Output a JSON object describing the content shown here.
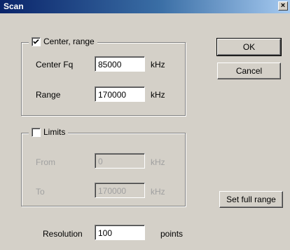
{
  "window": {
    "title": "Scan",
    "close_glyph": "×"
  },
  "center_group": {
    "checkbox_label": "Center, range",
    "checked": true,
    "center_label": "Center Fq",
    "center_value": "85000",
    "center_unit": "kHz",
    "range_label": "Range",
    "range_value": "170000",
    "range_unit": "kHz"
  },
  "limits_group": {
    "checkbox_label": "Limits",
    "checked": false,
    "from_label": "From",
    "from_value": "0",
    "from_unit": "kHz",
    "to_label": "To",
    "to_value": "170000",
    "to_unit": "kHz"
  },
  "resolution": {
    "label": "Resolution",
    "value": "100",
    "unit": "points"
  },
  "buttons": {
    "ok": "OK",
    "cancel": "Cancel",
    "set_full_range": "Set full range"
  },
  "colors": {
    "face": "#d4d0c8",
    "title_start": "#0a246a",
    "title_end": "#a6caf0",
    "disabled_text": "#a0a0a0"
  }
}
